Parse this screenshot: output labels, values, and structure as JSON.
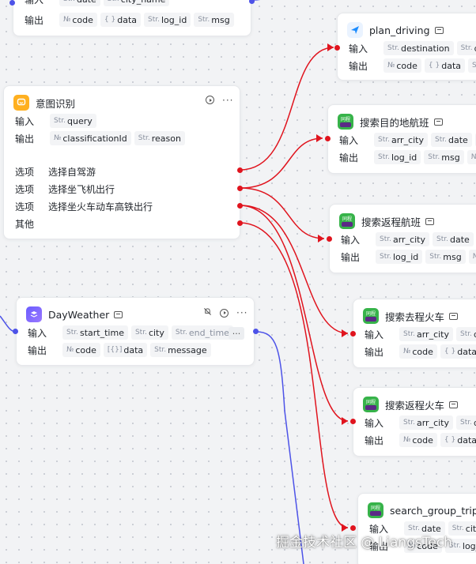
{
  "labels": {
    "input": "输入",
    "output": "输出",
    "option": "选项",
    "other": "其他"
  },
  "types": {
    "str": "Str.",
    "num": "№",
    "obj": "{ }",
    "arr": "[{}]"
  },
  "top_node": {
    "inputs": [
      "date",
      "city_name"
    ],
    "outputs": [
      [
        "num",
        "code"
      ],
      [
        "obj",
        "data"
      ],
      [
        "str",
        "log_id"
      ],
      [
        "str",
        "msg"
      ]
    ]
  },
  "intent_node": {
    "title": "意图识别",
    "inputs": [
      "query"
    ],
    "outputs": [
      [
        "num",
        "classificationId"
      ],
      [
        "str",
        "reason"
      ]
    ],
    "options": [
      "选择自驾游",
      "选择坐飞机出行",
      "选择坐火车动车高铁出行"
    ]
  },
  "weather_node": {
    "title": "DayWeather",
    "inputs": [
      "start_time",
      "city",
      "end_time"
    ],
    "outputs": [
      [
        "num",
        "code"
      ],
      [
        "arr",
        "data"
      ],
      [
        "str",
        "message"
      ]
    ],
    "more": "···"
  },
  "plan_node": {
    "title": "plan_driving",
    "inputs": [
      "destination",
      "disal"
    ],
    "outputs": [
      [
        "num",
        "code"
      ],
      [
        "obj",
        "data"
      ],
      [
        "str",
        "lo"
      ]
    ]
  },
  "flight_out_node": {
    "title": "搜索目的地航班",
    "inputs": [
      "arr_city",
      "date",
      "c"
    ],
    "outputs": [
      [
        "str",
        "log_id"
      ],
      [
        "str",
        "msg"
      ],
      [
        "num",
        "co"
      ]
    ]
  },
  "flight_back_node": {
    "title": "搜索返程航班",
    "inputs": [
      "arr_city",
      "date",
      "c"
    ],
    "outputs": [
      [
        "str",
        "log_id"
      ],
      [
        "str",
        "msg"
      ],
      [
        "num",
        "co"
      ]
    ]
  },
  "train_out_node": {
    "title": "搜索去程火车",
    "inputs": [
      "arr_city",
      "dep"
    ],
    "outputs": [
      [
        "num",
        "code"
      ],
      [
        "obj",
        "data"
      ]
    ]
  },
  "train_back_node": {
    "title": "搜索返程火车",
    "inputs": [
      "arr_city",
      "date"
    ],
    "outputs": [
      [
        "num",
        "code"
      ],
      [
        "obj",
        "data"
      ]
    ]
  },
  "group_node": {
    "title": "search_group_trip",
    "inputs": [
      "date",
      "city_n"
    ],
    "outputs": [
      [
        "num",
        "code"
      ],
      [
        "str",
        "log_id"
      ]
    ]
  },
  "watermark": "掘金技术社区 @ LiangsTech",
  "colors": {
    "edge_red": "#e0141e",
    "edge_blue": "#4d53e8"
  }
}
